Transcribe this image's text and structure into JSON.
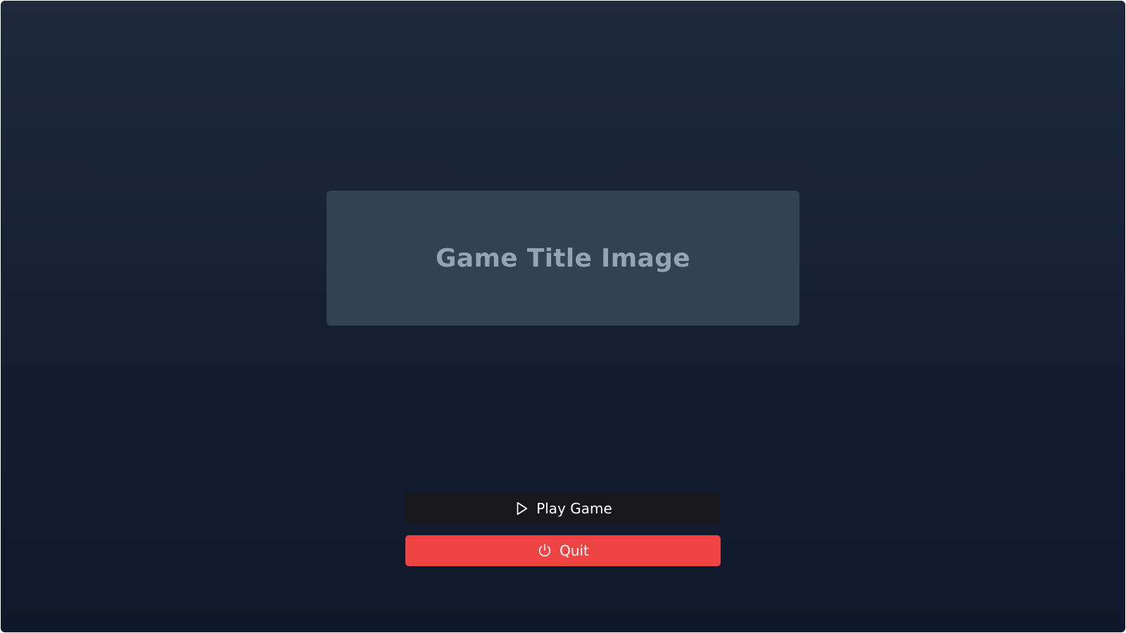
{
  "title_panel": {
    "text": "Game Title Image"
  },
  "menu": {
    "play": {
      "label": "Play Game",
      "icon": "play-icon",
      "color": "#18181b"
    },
    "quit": {
      "label": "Quit",
      "icon": "power-icon",
      "color": "#ef4444"
    }
  },
  "colors": {
    "background_top": "#1e293b",
    "background_bottom": "#0f172a",
    "panel": "#334155",
    "panel_text": "#94a3b8"
  }
}
